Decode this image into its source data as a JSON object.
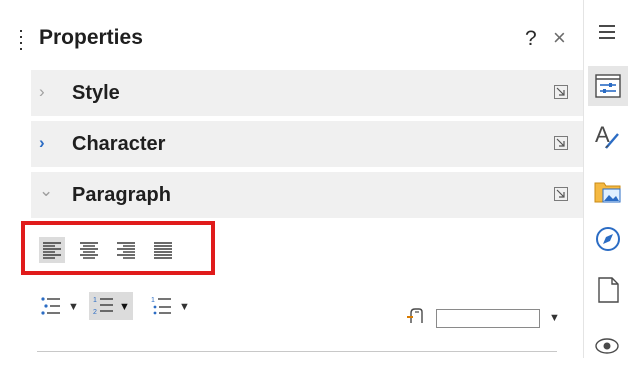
{
  "panel": {
    "title": "Properties",
    "help_label": "?",
    "close_label": "×"
  },
  "decks": [
    {
      "label": "Style",
      "state": "collapsed"
    },
    {
      "label": "Character",
      "state": "collapsed-focused"
    },
    {
      "label": "Paragraph",
      "state": "expanded"
    }
  ],
  "chevrons": {
    "collapsed": "›",
    "expanded": "⌄"
  },
  "paragraph": {
    "alignment_buttons": [
      "align-left",
      "align-center",
      "align-right",
      "justify"
    ],
    "active_alignment": "align-left",
    "list_buttons": [
      "unordered-list",
      "ordered-list",
      "outline-list"
    ],
    "active_list": "ordered-list",
    "dropdown_glyph": "▼"
  },
  "sidebar_tabs": [
    "properties",
    "styles",
    "gallery",
    "navigator",
    "page",
    "style-inspector"
  ],
  "colors": {
    "highlight": "#e01b1b",
    "accent": "#2b6cc4",
    "deck_bg": "#f0f0f0"
  }
}
